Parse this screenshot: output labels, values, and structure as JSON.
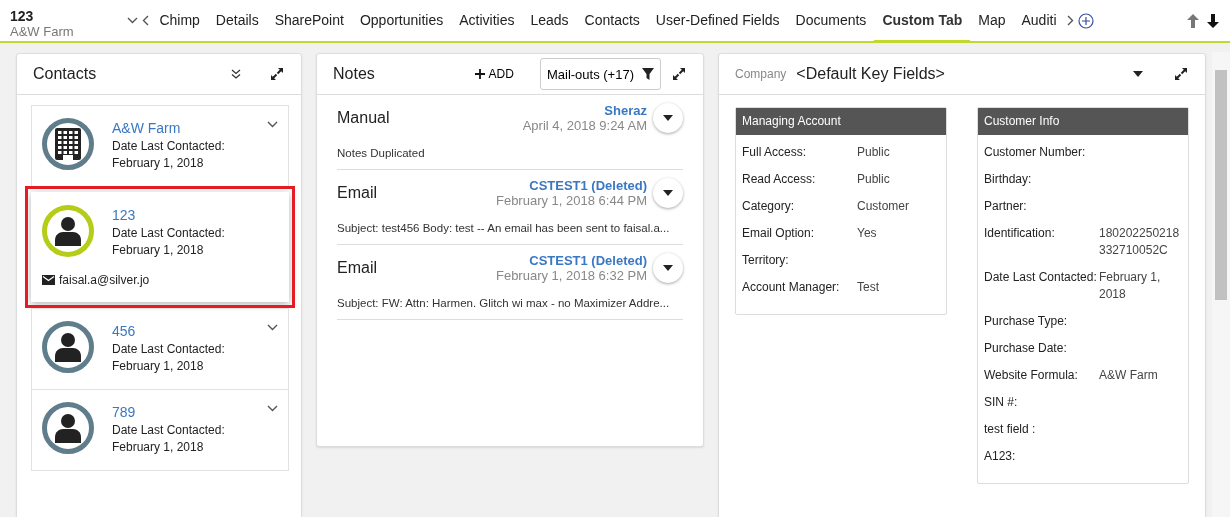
{
  "record": {
    "title": "123",
    "subtitle": "A&W Farm"
  },
  "tabs": [
    {
      "label": "Chimp",
      "selected": false
    },
    {
      "label": "Details",
      "selected": false
    },
    {
      "label": "SharePoint",
      "selected": false
    },
    {
      "label": "Opportunities",
      "selected": false
    },
    {
      "label": "Activities",
      "selected": false
    },
    {
      "label": "Leads",
      "selected": false
    },
    {
      "label": "Contacts",
      "selected": false
    },
    {
      "label": "User-Defined Fields",
      "selected": false
    },
    {
      "label": "Documents",
      "selected": false
    },
    {
      "label": "Custom Tab",
      "selected": true
    },
    {
      "label": "Map",
      "selected": false
    },
    {
      "label": "Auditi",
      "selected": false
    }
  ],
  "contacts": {
    "title": "Contacts",
    "items": [
      {
        "kind": "company",
        "name": "A&W Farm",
        "label": "Date Last Contacted:",
        "date": "February 1, 2018",
        "selected": false
      },
      {
        "kind": "person",
        "name": "123",
        "label": "Date Last Contacted:",
        "date": "February 1, 2018",
        "email": "faisal.a@silver.jo",
        "selected": true
      },
      {
        "kind": "person",
        "name": "456",
        "label": "Date Last Contacted:",
        "date": "February 1, 2018",
        "selected": false
      },
      {
        "kind": "person",
        "name": "789",
        "label": "Date Last Contacted:",
        "date": "February 1, 2018",
        "selected": false
      }
    ]
  },
  "notes": {
    "title": "Notes",
    "add_label": "ADD",
    "filter": "Mail-outs (+17)",
    "items": [
      {
        "type": "Manual",
        "author": "Sheraz",
        "date": "April 4, 2018 9:24 AM",
        "body": "Notes Duplicated"
      },
      {
        "type": "Email",
        "author": "CSTEST1 (Deleted)",
        "date": "February 1, 2018 6:44 PM",
        "body": "Subject: test456 Body: test -- An email has been sent to faisal.a..."
      },
      {
        "type": "Email",
        "author": "CSTEST1 (Deleted)",
        "date": "February 1, 2018 6:32 PM",
        "body": "Subject: FW: Attn: Harmen. Glitch wi max - no Maximizer Addre..."
      }
    ]
  },
  "key_fields": {
    "label": "Company",
    "title": "<Default Key Fields>",
    "groups": [
      {
        "title": "Managing Account",
        "rows": [
          {
            "label": "Full Access:",
            "value": "Public"
          },
          {
            "label": "Read Access:",
            "value": "Public"
          },
          {
            "label": "Category:",
            "value": "Customer"
          },
          {
            "label": "Email Option:",
            "value": "Yes"
          },
          {
            "label": "Territory:"
          },
          {
            "label": "Account Manager:",
            "value": "Test"
          }
        ]
      },
      {
        "title": "Customer Info",
        "rows": [
          {
            "label": "Customer Number:"
          },
          {
            "label": "Birthday:"
          },
          {
            "label": "Partner:"
          },
          {
            "label": "Identification:",
            "value": "180202250218 332710052C"
          },
          {
            "label": "Date Last Contacted:",
            "value": "February 1, 2018"
          },
          {
            "label": "Purchase Type:"
          },
          {
            "label": "Purchase Date:"
          },
          {
            "label": "Website Formula:",
            "value": "A&W Farm"
          },
          {
            "label": "SIN #:"
          },
          {
            "label": "test field :"
          },
          {
            "label": "A123:"
          }
        ]
      }
    ]
  }
}
